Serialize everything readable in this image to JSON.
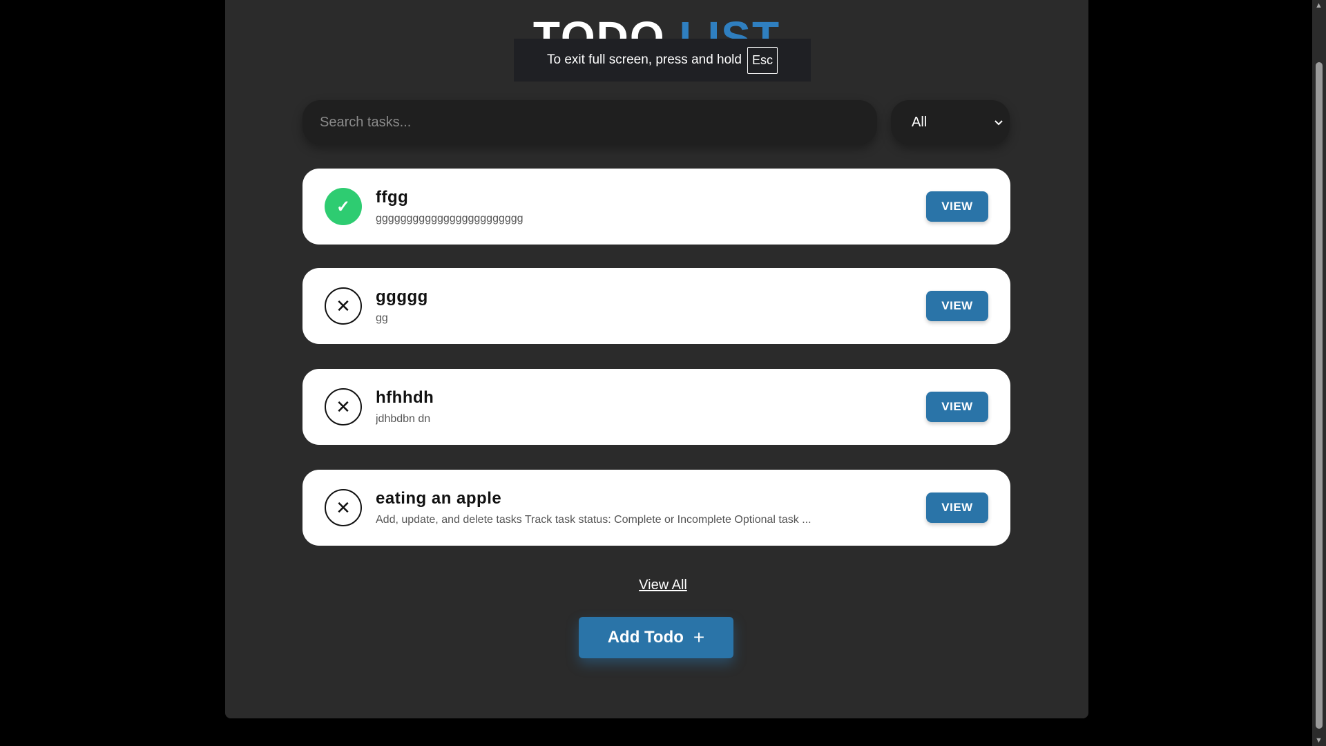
{
  "header": {
    "title_main": "TODO ",
    "title_accent": "LIST"
  },
  "fullscreen_notice": {
    "text": "To exit full screen, press and hold",
    "key": "Esc"
  },
  "search": {
    "placeholder": "Search tasks..."
  },
  "filter": {
    "selected": "All"
  },
  "todos": [
    {
      "title": "ffgg",
      "description": "gggggggggggggggggggggggg",
      "status": "complete",
      "view_label": "VIEW"
    },
    {
      "title": "ggggg",
      "description": "gg",
      "status": "incomplete",
      "view_label": "VIEW"
    },
    {
      "title": "hfhhdh",
      "description": "jdhbdbn dn",
      "status": "incomplete",
      "view_label": "VIEW"
    },
    {
      "title": "eating an apple",
      "description": "Add, update, and delete tasks Track task status: Complete or Incomplete Optional task ...",
      "status": "incomplete",
      "view_label": "VIEW"
    }
  ],
  "view_all_label": "View All",
  "add_button": {
    "label": "Add Todo",
    "icon": "+"
  },
  "colors": {
    "accent": "#2a74a8",
    "complete": "#2ecc71",
    "panel": "#2b2b2b"
  }
}
